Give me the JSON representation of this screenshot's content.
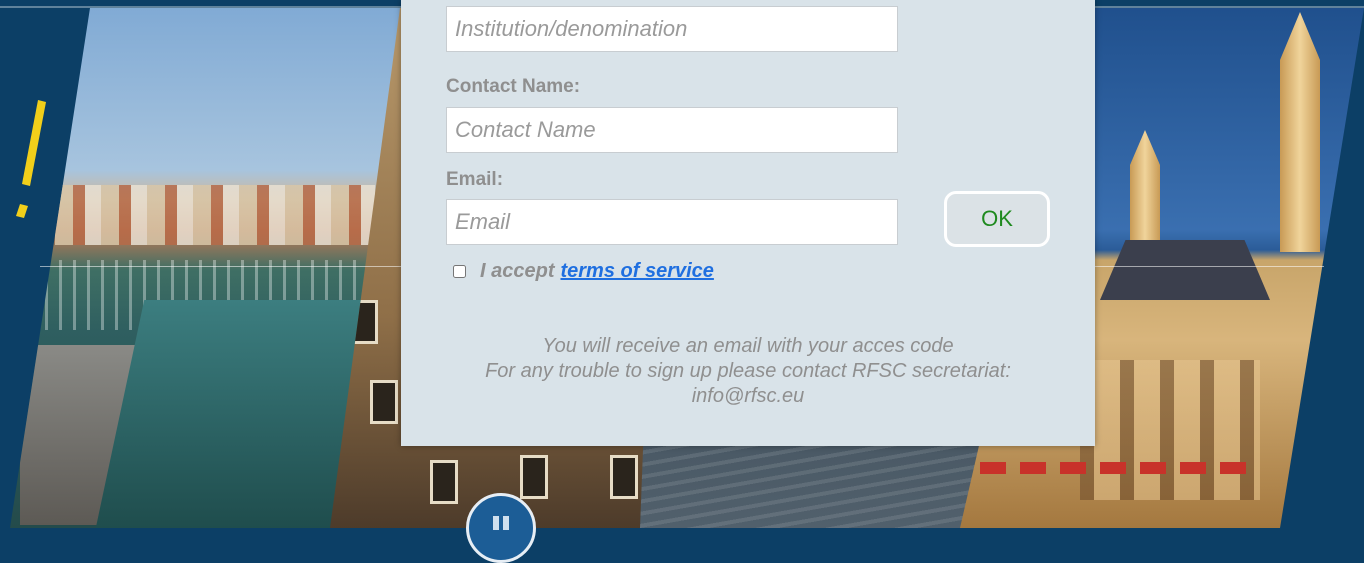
{
  "form": {
    "institution_placeholder": "Institution/denomination",
    "contact_label": "Contact Name:",
    "contact_placeholder": "Contact Name",
    "email_label": "Email:",
    "email_placeholder": "Email",
    "ok_label": "OK",
    "accept_text": "I accept",
    "terms_link": "terms of service"
  },
  "info": {
    "line1": "You will receive an email with your acces code",
    "line2": "For any trouble to sign up please contact RFSC secretariat:",
    "line3": "info@rfsc.eu"
  },
  "slideshow": {
    "control_icon": "pause-icon"
  },
  "colors": {
    "background": "#0c3f66",
    "dialog": "#d9e3e9",
    "ok_text": "#1f8a1f",
    "link": "#1f6fe0",
    "accent_yellow": "#f2cf1a"
  }
}
